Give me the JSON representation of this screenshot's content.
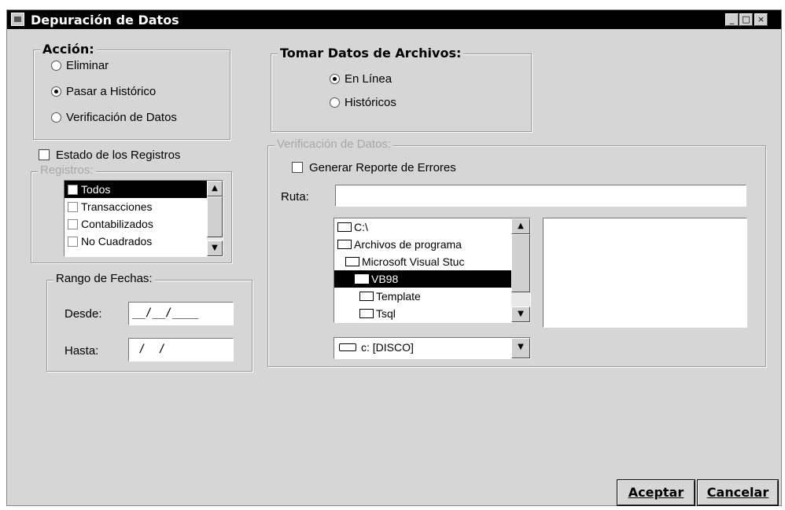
{
  "window": {
    "title": "Depuración de Datos",
    "controls": {
      "minimize": "_",
      "maximize": "□",
      "close": "×"
    }
  },
  "accion": {
    "legend": "Acción:",
    "options": [
      {
        "label": "Eliminar",
        "selected": false
      },
      {
        "label": "Pasar a Histórico",
        "selected": true
      },
      {
        "label": "Verificación de Datos",
        "selected": false
      }
    ]
  },
  "tomar_datos": {
    "legend": "Tomar Datos de Archivos:",
    "options": [
      {
        "label": "En Línea",
        "selected": true
      },
      {
        "label": "Históricos",
        "selected": false
      }
    ]
  },
  "estado": {
    "label": "Estado de los Registros",
    "checked": false
  },
  "registros": {
    "legend": "Registros:",
    "items": [
      {
        "label": "Todos",
        "selected": true
      },
      {
        "label": "Transacciones",
        "selected": false
      },
      {
        "label": "Contabilizados",
        "selected": false
      },
      {
        "label": "No Cuadrados",
        "selected": false
      }
    ]
  },
  "rango_fechas": {
    "legend": "Rango de Fechas:",
    "desde_label": "Desde:",
    "desde_value": "__/__/____",
    "hasta_label": "Hasta:",
    "hasta_value": " /  /"
  },
  "verificacion": {
    "legend": "Verificación de Datos:",
    "generar_label": "Generar Reporte de Errores",
    "generar_checked": false,
    "ruta_label": "Ruta:",
    "ruta_value": "",
    "folders": [
      {
        "label": "C:\\",
        "icon": "open-folder-icon",
        "selected": false
      },
      {
        "label": "Archivos de programa",
        "icon": "open-folder-icon",
        "selected": false
      },
      {
        "label": "Microsoft Visual Stuc",
        "icon": "open-folder-icon",
        "selected": false
      },
      {
        "label": "VB98",
        "icon": "open-folder-icon",
        "selected": true
      },
      {
        "label": "Template",
        "icon": "folder-icon",
        "selected": false
      },
      {
        "label": "Tsql",
        "icon": "folder-icon",
        "selected": false
      }
    ],
    "drive": "c: [DISCO]"
  },
  "buttons": {
    "aceptar": "Aceptar",
    "cancelar": "Cancelar"
  },
  "colors": {
    "window_bg": "#d6d6d6",
    "titlebar": "#000000",
    "selection": "#000000"
  }
}
